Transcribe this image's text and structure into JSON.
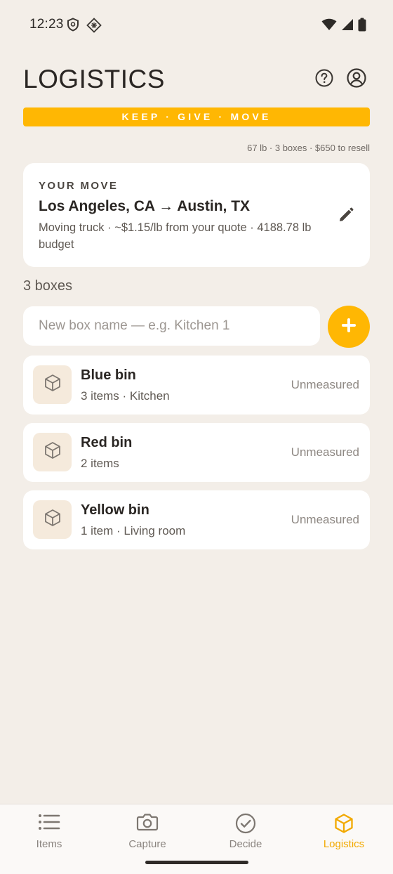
{
  "status_bar": {
    "time": "12:23"
  },
  "header": {
    "title": "LOGISTICS",
    "banner": "KEEP · GIVE · MOVE",
    "summary": "67 lb · 3 boxes · $650 to resell"
  },
  "move": {
    "eyebrow": "YOUR MOVE",
    "route": "Los Angeles, CA → Austin, TX",
    "detail": "Moving truck · ~$1.15/lb from your quote · 4188.78 lb budget"
  },
  "boxes": {
    "count_label": "3 boxes",
    "input_placeholder": "New box name — e.g. Kitchen 1",
    "items": [
      {
        "name": "Blue bin",
        "meta": "3 items · Kitchen",
        "status": "Unmeasured"
      },
      {
        "name": "Red bin",
        "meta": "2 items",
        "status": "Unmeasured"
      },
      {
        "name": "Yellow bin",
        "meta": "1 item · Living room",
        "status": "Unmeasured"
      }
    ]
  },
  "nav": {
    "items": [
      {
        "label": "Items",
        "icon": "list-icon"
      },
      {
        "label": "Capture",
        "icon": "camera-icon"
      },
      {
        "label": "Decide",
        "icon": "check-circle-icon"
      },
      {
        "label": "Logistics",
        "icon": "box-icon"
      }
    ],
    "active": "Logistics"
  },
  "colors": {
    "accent": "#ffb703",
    "background": "#f3eee8",
    "nav_active": "#f2a900"
  }
}
